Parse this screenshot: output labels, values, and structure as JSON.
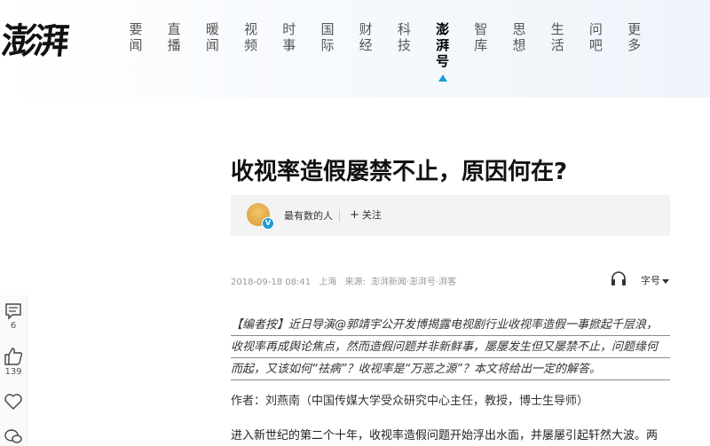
{
  "header": {
    "logo": "澎湃",
    "nav": [
      {
        "label": "要闻"
      },
      {
        "label": "直播"
      },
      {
        "label": "暖闻"
      },
      {
        "label": "视频"
      },
      {
        "label": "时事"
      },
      {
        "label": "国际"
      },
      {
        "label": "财经"
      },
      {
        "label": "科技"
      },
      {
        "label": "澎湃号",
        "active": true
      },
      {
        "label": "智库"
      },
      {
        "label": "思想"
      },
      {
        "label": "生活"
      },
      {
        "label": "问吧"
      },
      {
        "label": "更多"
      }
    ],
    "accent_color": "#1b9bd6"
  },
  "article": {
    "title": "收视率造假屡禁不止，原因何在?",
    "author": {
      "name": "最有数的人",
      "verified_badge": "V"
    },
    "follow_label": "关注",
    "meta": {
      "datetime": "2018-09-18 08:41",
      "location": "上海",
      "source_label": "来源:",
      "source": "澎湃新闻·澎湃号·湃客"
    },
    "font_size_label": "字号",
    "editor_note_lines": [
      "【编者按】近日导演@郭靖宇公开发博揭露电视剧行业收视率造假一事掀起千层浪，",
      "收视率再成舆论焦点，然而造假问题并非新鲜事，屡屡发生但又屡禁不止，问题缘何",
      "而起，又该如何“祛病”？收视率是“万恶之源”？本文将给出一定的解答。"
    ],
    "byline": "作者：刘燕南（中国传媒大学受众研究中心主任，教授，博士生导师）",
    "body_first_line": "进入新世纪的第二个十年，收视率造假问题开始浮出水面，并屡屡引起轩然大波。两"
  },
  "side_toolbar": {
    "comment_count": "6",
    "like_count": "139"
  }
}
